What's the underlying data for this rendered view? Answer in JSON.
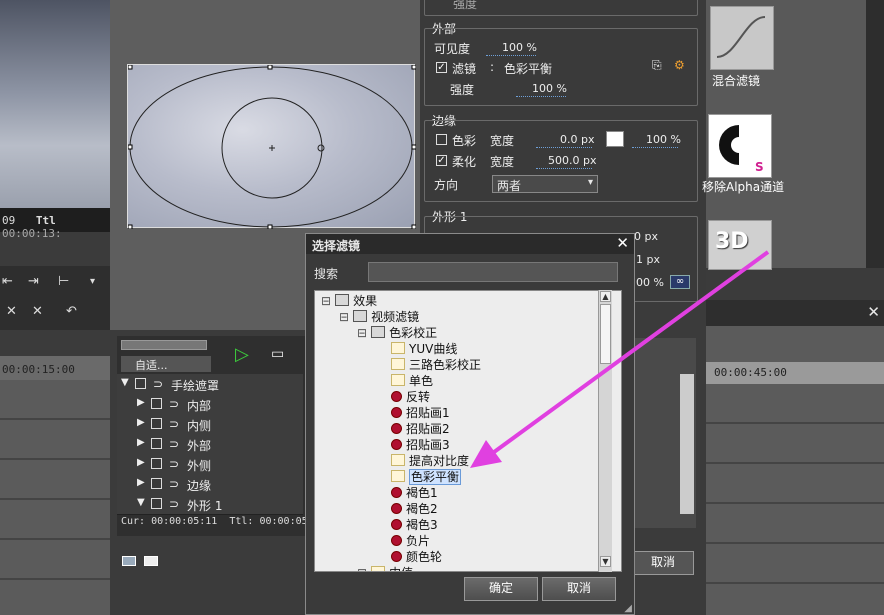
{
  "left": {
    "timecode_in": "09",
    "timecode_total_label": "Ttl",
    "timecode_total": "00:00:13:",
    "ruler_time": "00:00:15:00"
  },
  "settings": {
    "top_strength_label": "强度",
    "outer": {
      "title": "外部",
      "visibility_label": "可见度",
      "visibility_value": "100 %",
      "filter_label": "滤镜",
      "filter_value": "色彩平衡",
      "strength_label": "强度",
      "strength_value": "100 %"
    },
    "edge": {
      "title": "边缘",
      "color_label": "色彩",
      "color_width_label": "宽度",
      "color_width_value": "0.0 px",
      "color_pct": "100 %",
      "soft_label": "柔化",
      "soft_width_label": "宽度",
      "soft_width_value": "500.0 px",
      "direction_label": "方向",
      "direction_value": "两者"
    },
    "shape": {
      "title": "外形 1",
      "v1": "0 px",
      "v2": "1 px",
      "v3": "00 %"
    }
  },
  "thumbs": [
    {
      "label": "混合滤镜"
    },
    {
      "label": "移除Alpha通道"
    },
    {
      "label": "3D"
    }
  ],
  "right_timeline": {
    "ruler_time": "00:00:45:00"
  },
  "layers": {
    "mode": "自适...",
    "rows": [
      {
        "label": "手绘遮罩"
      },
      {
        "label": "内部"
      },
      {
        "label": "内侧"
      },
      {
        "label": "外部"
      },
      {
        "label": "外侧"
      },
      {
        "label": "边缘"
      },
      {
        "label": "外形 1"
      }
    ],
    "cur": "Cur: 00:00:05:11",
    "ttl": "Ttl: 00:00:05"
  },
  "dialog": {
    "title": "选择滤镜",
    "search_label": "搜索",
    "search_value": "",
    "tree": [
      {
        "label": "效果",
        "level": 0,
        "icon": "folder"
      },
      {
        "label": "视频滤镜",
        "level": 1,
        "icon": "folder"
      },
      {
        "label": "色彩校正",
        "level": 2,
        "icon": "folder"
      },
      {
        "label": "YUV曲线",
        "level": 3,
        "icon": "file"
      },
      {
        "label": "三路色彩校正",
        "level": 3,
        "icon": "file"
      },
      {
        "label": "单色",
        "level": 3,
        "icon": "file"
      },
      {
        "label": "反转",
        "level": 3,
        "icon": "filter"
      },
      {
        "label": "招贴画1",
        "level": 3,
        "icon": "filter"
      },
      {
        "label": "招贴画2",
        "level": 3,
        "icon": "filter"
      },
      {
        "label": "招贴画3",
        "level": 3,
        "icon": "filter"
      },
      {
        "label": "提高对比度",
        "level": 3,
        "icon": "file"
      },
      {
        "label": "色彩平衡",
        "level": 3,
        "icon": "file",
        "selected": true
      },
      {
        "label": "褐色1",
        "level": 3,
        "icon": "filter"
      },
      {
        "label": "褐色2",
        "level": 3,
        "icon": "filter"
      },
      {
        "label": "褐色3",
        "level": 3,
        "icon": "filter"
      },
      {
        "label": "负片",
        "level": 3,
        "icon": "filter"
      },
      {
        "label": "颜色轮",
        "level": 3,
        "icon": "filter"
      },
      {
        "label": "中值",
        "level": 2,
        "icon": "file"
      }
    ],
    "ok_label": "确定",
    "cancel_label": "取消"
  },
  "behind_cancel_label": "取消",
  "colors": {
    "accent_arrow": "#e040e0",
    "selection": "#cfe3ff",
    "play_green": "#3ccc3c"
  }
}
